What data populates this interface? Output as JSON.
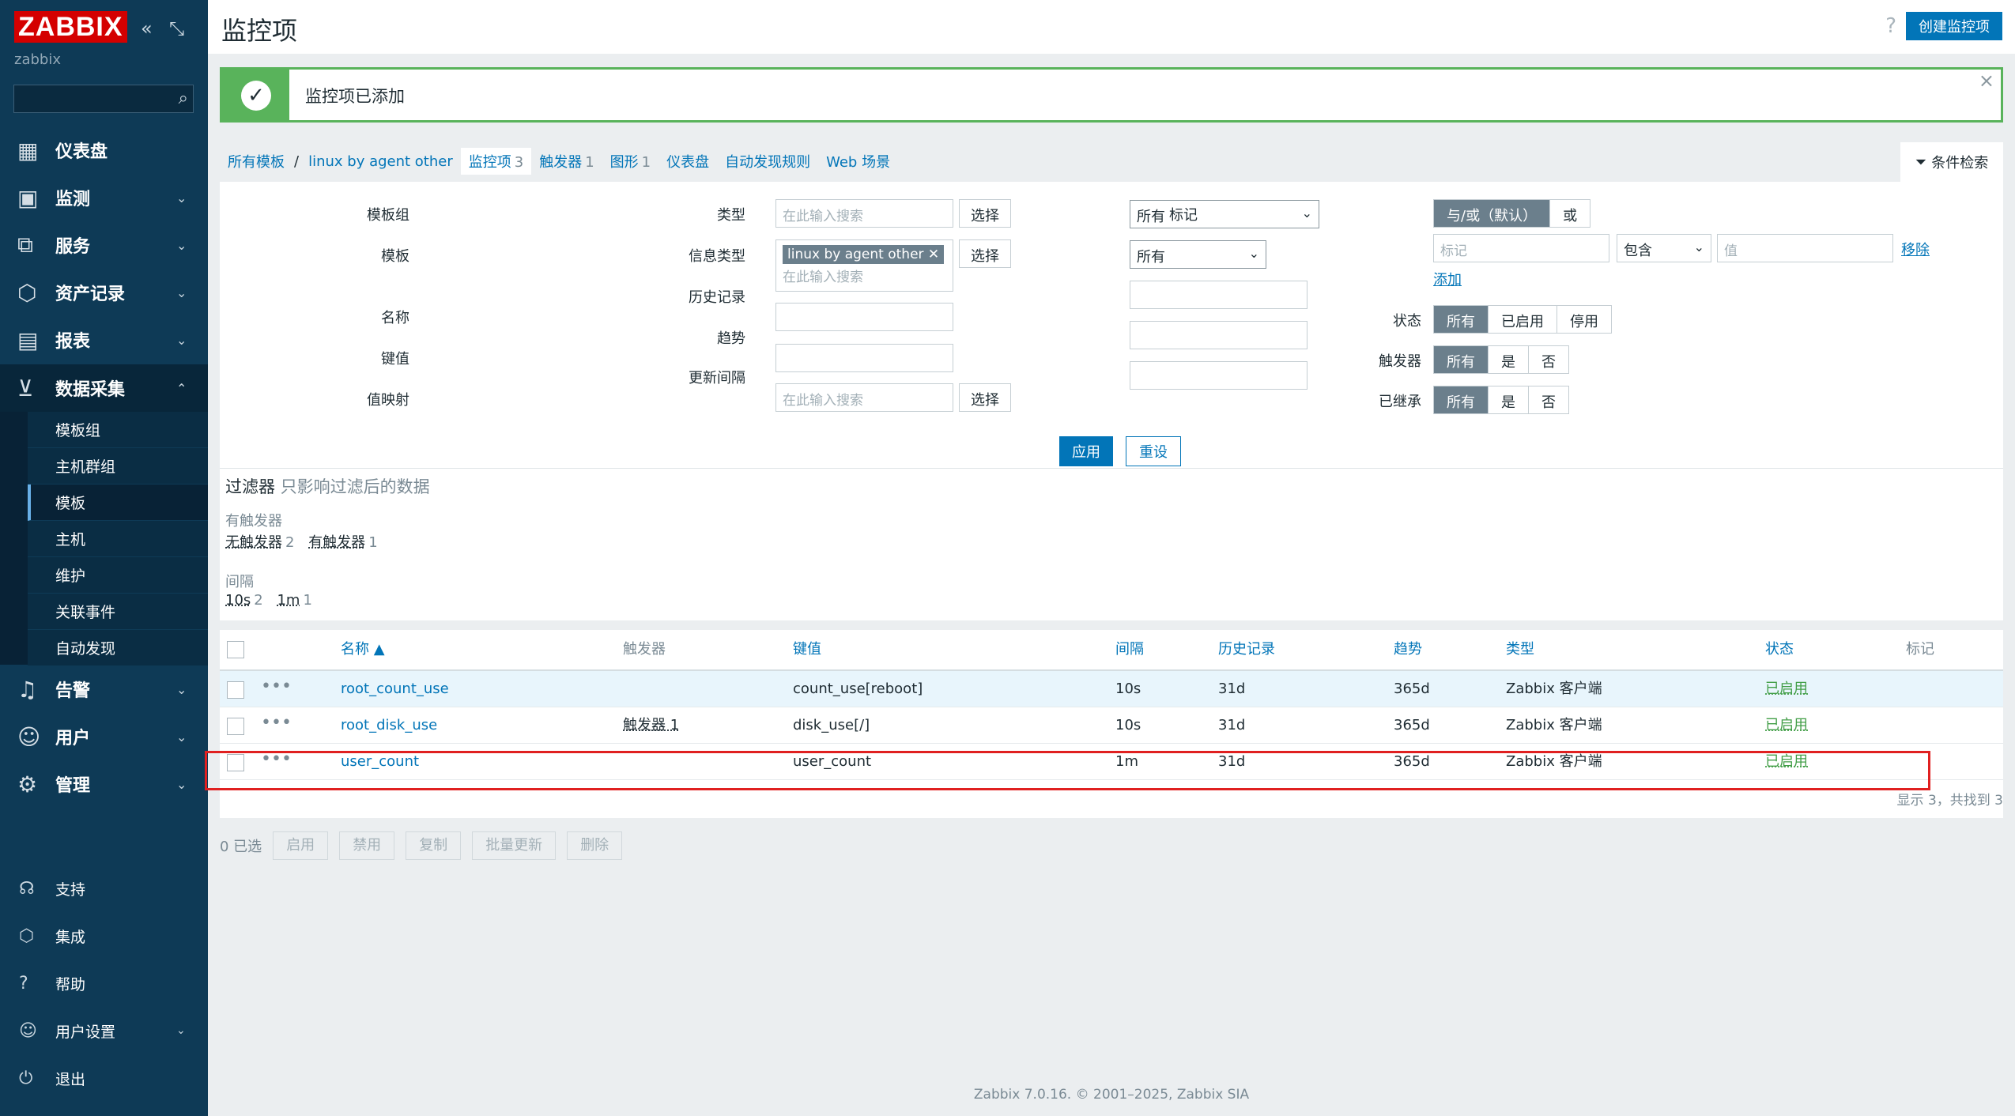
{
  "sidebar": {
    "logo": "ZABBIX",
    "host": "zabbix",
    "nav": [
      {
        "label": "仪表盘",
        "icon": "dashboard-icon"
      },
      {
        "label": "监测",
        "icon": "monitoring-icon"
      },
      {
        "label": "服务",
        "icon": "services-icon"
      },
      {
        "label": "资产记录",
        "icon": "inventory-icon"
      },
      {
        "label": "报表",
        "icon": "reports-icon"
      },
      {
        "label": "数据采集",
        "icon": "data-collection-icon"
      },
      {
        "label": "告警",
        "icon": "alerts-icon"
      },
      {
        "label": "用户",
        "icon": "users-icon"
      },
      {
        "label": "管理",
        "icon": "administration-icon"
      }
    ],
    "subnav": [
      "模板组",
      "主机群组",
      "模板",
      "主机",
      "维护",
      "关联事件",
      "自动发现"
    ],
    "footer": [
      "支持",
      "集成",
      "帮助",
      "用户设置",
      "退出"
    ]
  },
  "header": {
    "title": "监控项",
    "create_button": "创建监控项"
  },
  "message": "监控项已添加",
  "breadcrumbs": {
    "all_templates": "所有模板",
    "template": "linux by agent other",
    "items": "监控项",
    "items_count": "3",
    "triggers": "触发器",
    "triggers_count": "1",
    "graphs": "图形",
    "graphs_count": "1",
    "dashboards": "仪表盘",
    "discovery": "自动发现规则",
    "web": "Web 场景"
  },
  "filter_tab": "条件检索",
  "filter": {
    "template_group_label": "模板组",
    "template_label": "模板",
    "name_label": "名称",
    "key_label": "键值",
    "valuemap_label": "值映射",
    "search_placeholder": "在此输入搜索",
    "select_btn": "选择",
    "template_chip": "linux by agent other",
    "type_label": "类型",
    "type_value": "所有",
    "info_type_label": "信息类型",
    "info_type_value": "所有",
    "history_label": "历史记录",
    "trends_label": "趋势",
    "interval_label": "更新间隔",
    "tags_label": "标记",
    "and_or": "与/或（默认）",
    "or": "或",
    "tag_placeholder": "标记",
    "contains": "包含",
    "value_placeholder": "值",
    "remove": "移除",
    "add": "添加",
    "status_label": "状态",
    "status_opts": [
      "所有",
      "已启用",
      "停用"
    ],
    "triggers_label": "触发器",
    "yn_opts": [
      "所有",
      "是",
      "否"
    ],
    "inherited_label": "已继承",
    "apply": "应用",
    "reset": "重设",
    "title": "过滤器",
    "subtitle": "只影响过滤后的数据",
    "has_triggers_label": "有触发器",
    "no_triggers": "无触发器",
    "no_triggers_n": "2",
    "with_triggers": "有触发器",
    "with_triggers_n": "1",
    "interval_sum_label": "间隔",
    "i10s": "10s",
    "i10s_n": "2",
    "i1m": "1m",
    "i1m_n": "1"
  },
  "table": {
    "columns": [
      "名称 ▲",
      "触发器",
      "键值",
      "间隔",
      "历史记录",
      "趋势",
      "类型",
      "状态",
      "标记"
    ],
    "rows": [
      {
        "name": "root_count_use",
        "triggers": "",
        "key": "count_use[reboot]",
        "interval": "10s",
        "history": "31d",
        "trends": "365d",
        "type": "Zabbix 客户端",
        "status": "已启用"
      },
      {
        "name": "root_disk_use",
        "triggers": "触发器 1",
        "key": "disk_use[/]",
        "interval": "10s",
        "history": "31d",
        "trends": "365d",
        "type": "Zabbix 客户端",
        "status": "已启用"
      },
      {
        "name": "user_count",
        "triggers": "",
        "key": "user_count",
        "interval": "1m",
        "history": "31d",
        "trends": "365d",
        "type": "Zabbix 客户端",
        "status": "已启用"
      }
    ],
    "showing": "显示 3，共找到 3"
  },
  "actions": {
    "selected": "0 已选",
    "buttons": [
      "启用",
      "禁用",
      "复制",
      "批量更新",
      "删除"
    ]
  },
  "footer": "Zabbix 7.0.16. © 2001–2025, Zabbix SIA"
}
